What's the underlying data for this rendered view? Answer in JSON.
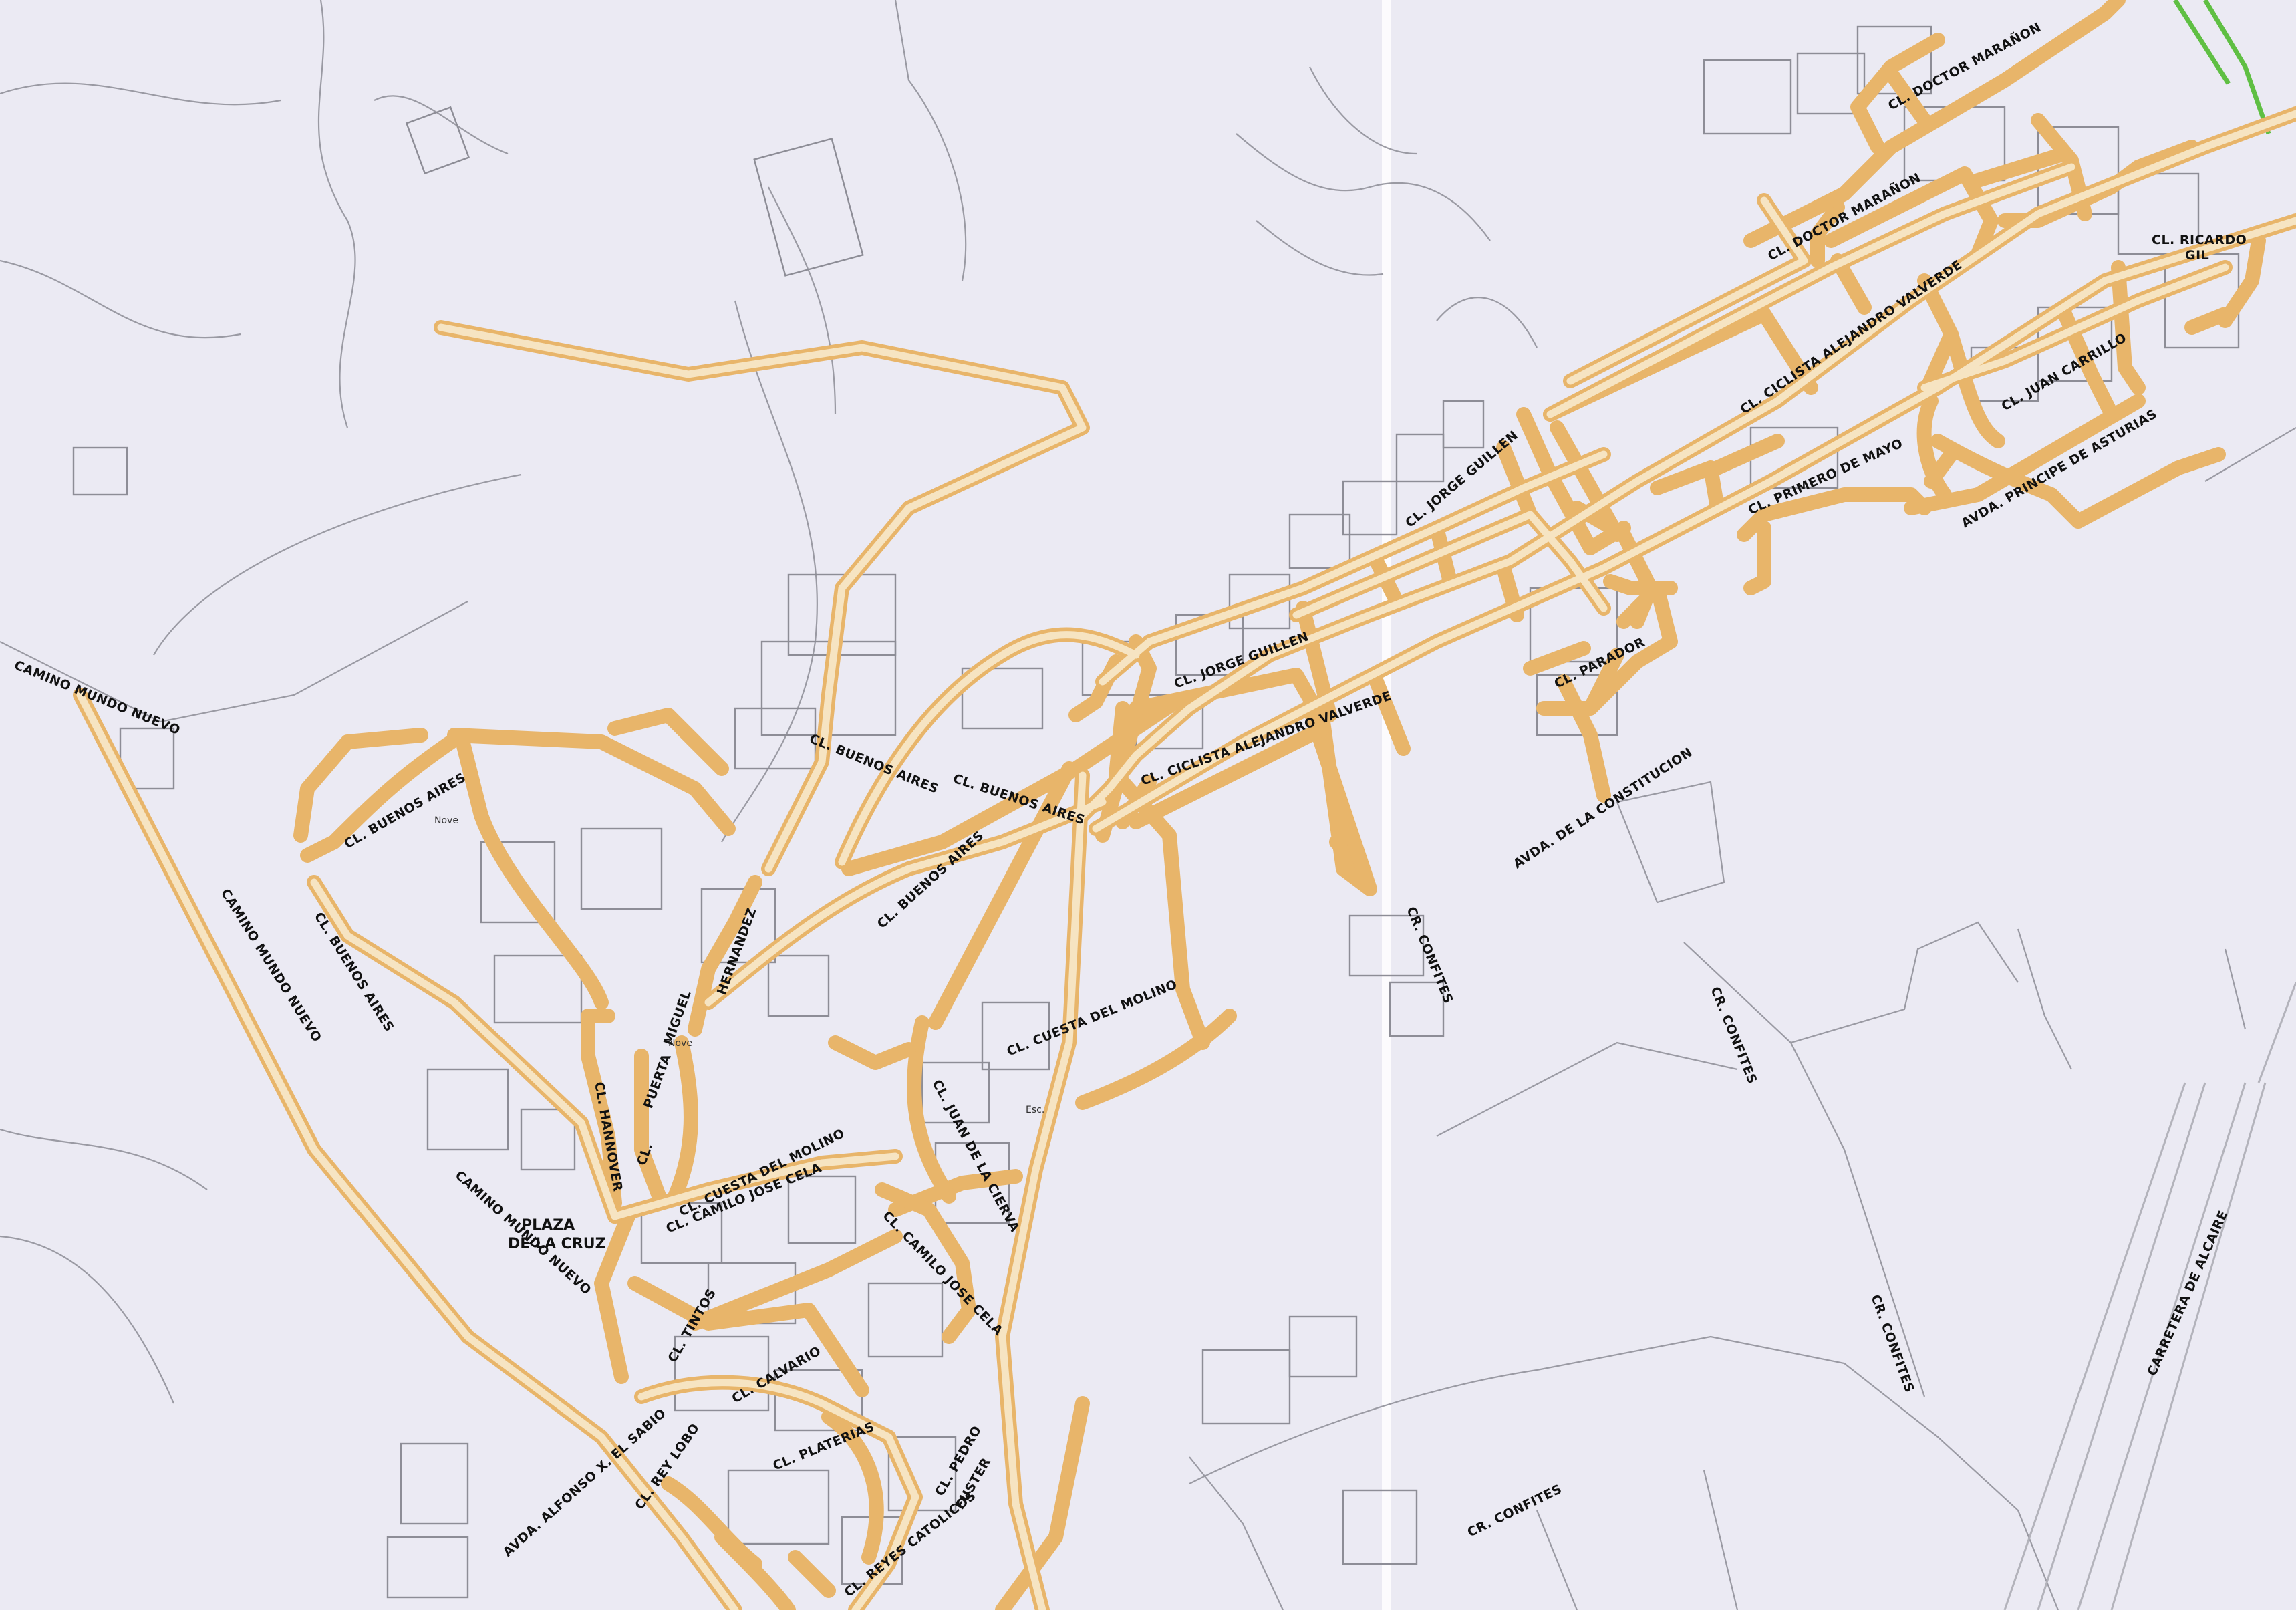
{
  "labels": {
    "camino_mundo_nuevo_nw": "CAMINO MUNDO NUEVO",
    "camino_mundo_nuevo_w": "CAMINO MUNDO NUEVO",
    "camino_mundo_nuevo_s": "CAMINO MUNDO NUEVO",
    "buenos_aires_1": "CL. BUENOS AIRES",
    "buenos_aires_2": "CL. BUENOS AIRES",
    "buenos_aires_3": "CL. BUENOS AIRES",
    "buenos_aires_4": "CL. BUENOS AIRES",
    "buenos_aires_5": "CL. BUENOS AIRES",
    "miguel_hernandez_1": "MIGUEL",
    "miguel_hernandez_2": "HERNANDEZ",
    "puerta": "PUERTA",
    "hannover": "CL. HANNOVER",
    "cl_short": "CL.",
    "cuesta_molino_1": "CL. CUESTA DEL MOLINO",
    "cuesta_molino_2": "CL. CUESTA DEL MOLINO",
    "camilo_jose_cela_1": "CL. CAMILO JOSE CELA",
    "camilo_jose_cela_2": "CL. CAMILO JOSE CELA",
    "juan_cierva": "CL. JUAN DE LA CIERVA",
    "plaza_1": "PLAZA",
    "plaza_2": "DE LA CRUZ",
    "tintos": "CL. TINTOS",
    "calvario": "CL. CALVARIO",
    "platerias": "CL. PLATERIAS",
    "reyes_catolicos": "CL. REYES CATOLICOS",
    "pedro": "CL. PEDRO",
    "pedro_2": "FUSTER",
    "alfonso": "AVDA. ALFONSO X. EL SABIO",
    "rey_lobo": "CL. REY LOBO",
    "jorge_guillen_1": "CL. JORGE GUILLEN",
    "jorge_guillen_2": "CL. JORGE GUILLEN",
    "ciclista_1": "CL. CICLISTA ALEJANDRO VALVERDE",
    "ciclista_2": "CL. CICLISTA ALEJANDRO VALVERDE",
    "doctor_maranon_1": "CL. DOCTOR MARAÑON",
    "doctor_maranon_2": "CL. DOCTOR MARAÑON",
    "ricardo_1": "CL. RICARDO",
    "ricardo_2": "GIL",
    "juan_carrillo": "CL. JUAN CARRILLO",
    "primero_mayo": "CL. PRIMERO DE MAYO",
    "principe_asturias": "AVDA. PRINCIPE DE ASTURIAS",
    "parador": "CL. PARADOR",
    "constitucion": "AVDA. DE LA CONSTITUCION",
    "confites_1": "CR. CONFITES",
    "confites_2": "CR. CONFITES",
    "confites_3": "CR. CONFITES",
    "confites_4": "CR. CONFITES",
    "carretera": "CARRETERA DE ALCAIRE",
    "nove_1": "Nove",
    "nove_2": "Nove",
    "esc": "Esc."
  },
  "colors": {
    "road_outer": "#e8b56a",
    "road_inner": "#f6e4c2",
    "paper": "#ebeaf3",
    "plot_lines": "#9a9aa3",
    "boundary_green": "#5fbf43"
  }
}
